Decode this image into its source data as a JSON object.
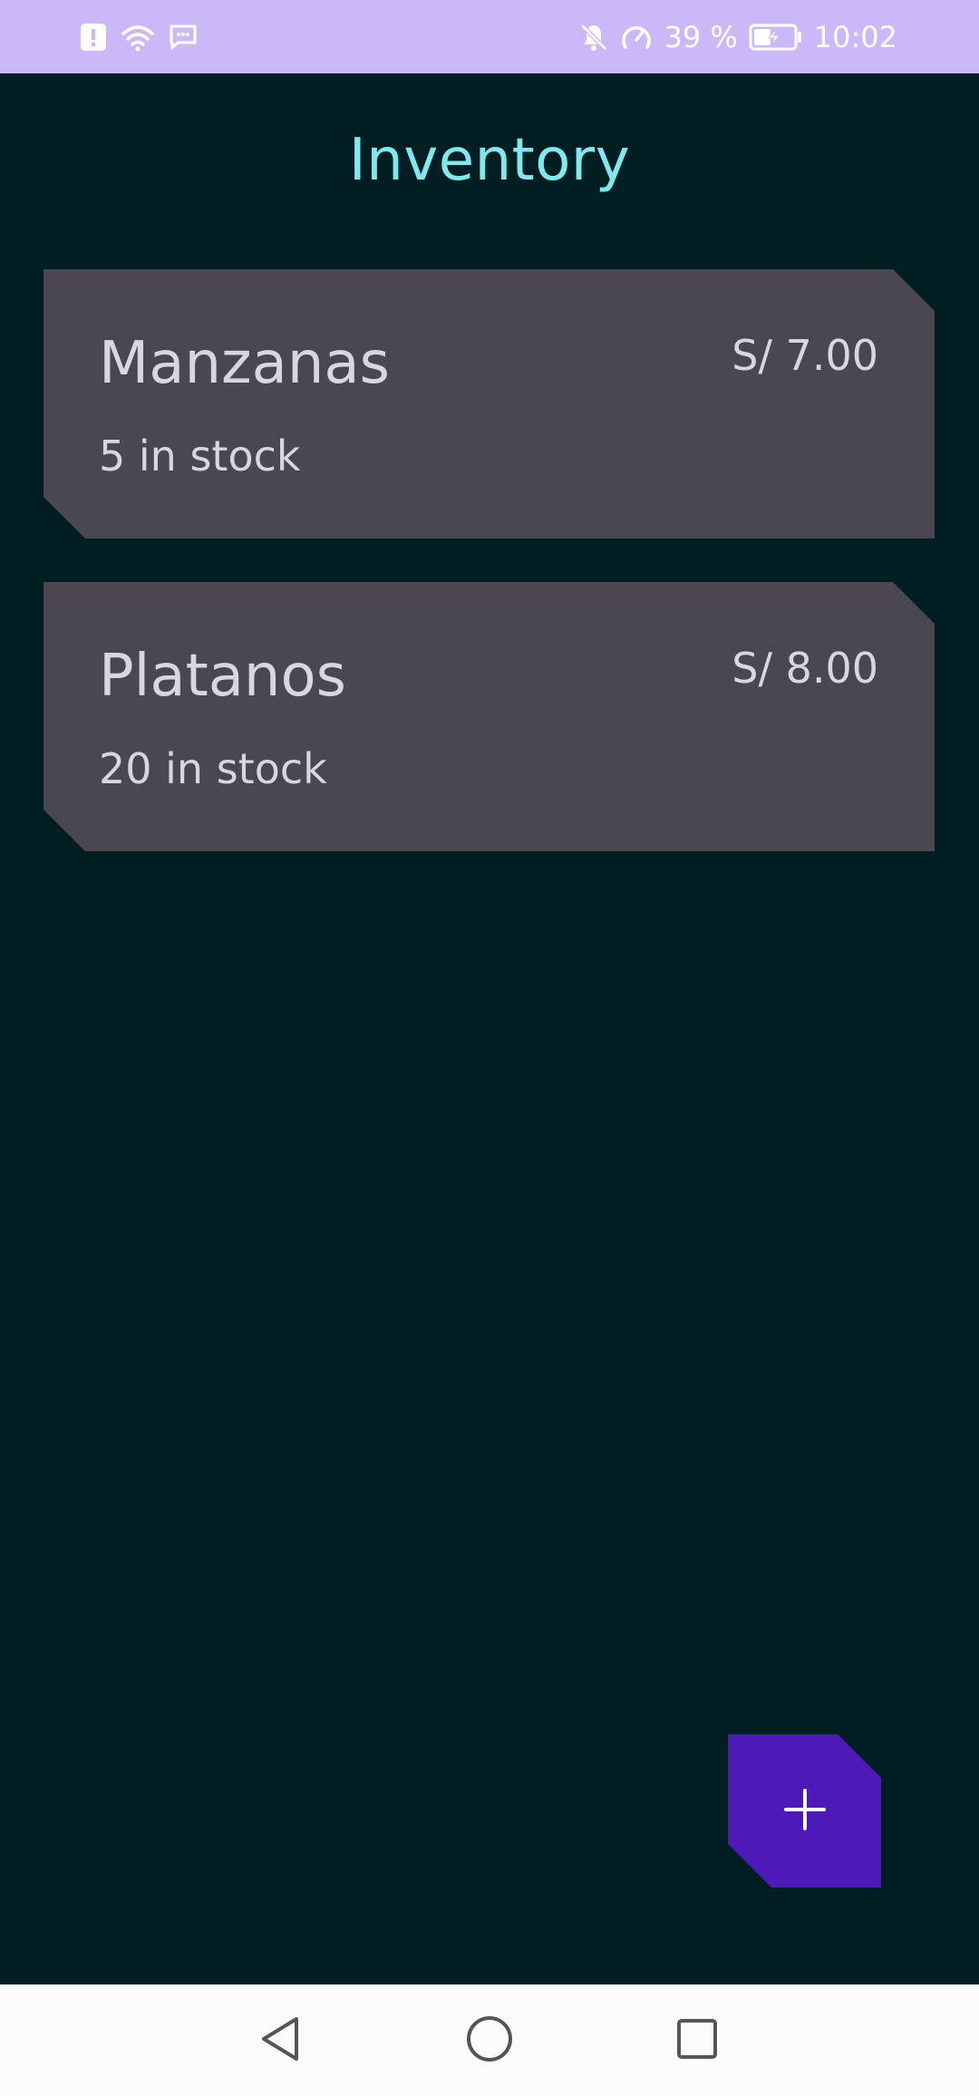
{
  "status_bar": {
    "battery_percent": "39 %",
    "time": "10:02",
    "icons_left": [
      "alert-icon",
      "wifi-icon",
      "message-icon"
    ],
    "icons_right": [
      "mute-icon",
      "speed-icon",
      "battery-charging-icon"
    ],
    "background_color": "#cbb8f8"
  },
  "app": {
    "title": "Inventory",
    "title_color": "#7ee9ef",
    "background_color": "#011f22"
  },
  "items": [
    {
      "name": "Manzanas",
      "stock": "5 in stock",
      "price": "S/ 7.00"
    },
    {
      "name": "Platanos",
      "stock": "20 in stock",
      "price": "S/ 8.00"
    }
  ],
  "fab": {
    "icon": "plus-icon",
    "color": "#4d1ab9"
  },
  "nav_bar": {
    "buttons": [
      "back-icon",
      "home-icon",
      "recents-icon"
    ]
  }
}
